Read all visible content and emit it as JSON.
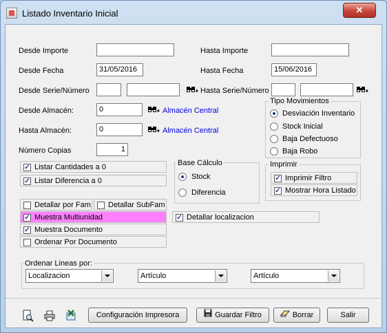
{
  "window": {
    "title": "Listado Inventario Inicial",
    "close_label": "✕"
  },
  "filters": {
    "desde_importe": {
      "label": "Desde Importe",
      "value": ""
    },
    "hasta_importe": {
      "label": "Hasta Importe",
      "value": ""
    },
    "desde_fecha": {
      "label": "Desde Fecha",
      "value": "31/05/2016"
    },
    "hasta_fecha": {
      "label": "Hasta Fecha",
      "value": "15/06/2016"
    },
    "desde_serie": {
      "label": "Desde Serie/Número",
      "serie": "",
      "numero": ""
    },
    "hasta_serie": {
      "label": "Hasta Serie/Número",
      "serie": "",
      "numero": ""
    },
    "desde_almacen": {
      "label": "Desde Almacén:",
      "value": "0",
      "link": "Almacén Central"
    },
    "hasta_almacen": {
      "label": "Hasta Almacén:",
      "value": "0",
      "link": "Almacén Central"
    },
    "numero_copias": {
      "label": "Número Copias",
      "value": "1"
    }
  },
  "tipo_movimientos": {
    "title": "Tipo Movimientos",
    "options": [
      {
        "label": "Desviación Inventario",
        "selected": true
      },
      {
        "label": "Stock Inicial",
        "selected": false
      },
      {
        "label": "Baja Defectuoso",
        "selected": false
      },
      {
        "label": "Baja Robo",
        "selected": false
      }
    ]
  },
  "listar": [
    {
      "label": "Listar Cantidades a 0",
      "checked": true
    },
    {
      "label": "Listar Diferencia a 0",
      "checked": true
    }
  ],
  "base_calculo": {
    "title": "Base Cálculo",
    "options": [
      {
        "label": "Stock",
        "selected": true
      },
      {
        "label": "Diferencia",
        "selected": false
      }
    ]
  },
  "imprimir": {
    "title": "Imprimir",
    "options": [
      {
        "label": "Imprimir Filtro",
        "checked": true
      },
      {
        "label": "Mostrar Hora Listado",
        "checked": true
      }
    ]
  },
  "detalle": {
    "detallar_fam": {
      "label": "Detallar por Fam",
      "checked": false
    },
    "detallar_subfam": {
      "label": "Detallar SubFam",
      "checked": false
    },
    "muestra_multiunidad": {
      "label": "Muestra Multiunidad",
      "checked": true,
      "highlight": "#ff80ff"
    },
    "muestra_documento": {
      "label": "Muestra Documento",
      "checked": true
    },
    "ordenar_documento": {
      "label": "Ordenar Por Documento",
      "checked": false
    },
    "detallar_localizacion": {
      "label": "Detallar localizacion",
      "checked": true
    }
  },
  "ordenar_lineas": {
    "title": "Ordenar Lineas por:",
    "combos": [
      "Localizacion",
      "Artículo",
      "Artículo"
    ]
  },
  "buttons": {
    "configuracion": "Configuración Impresora",
    "guardar": "Guardar Filtro",
    "borrar": "Borrar",
    "salir": "Salir"
  },
  "colors": {
    "link": "#0000e0",
    "highlight": "#ff80ff",
    "titlebar": "#b9d1ea"
  }
}
